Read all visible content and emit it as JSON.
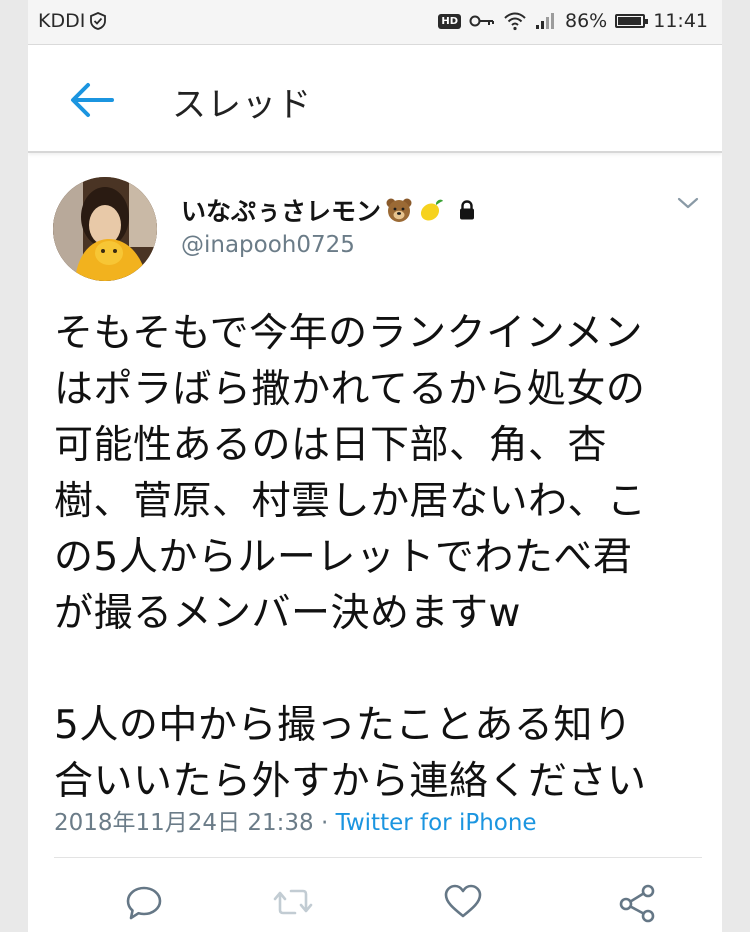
{
  "status_bar": {
    "carrier": "KDDI",
    "hd_badge": "HD",
    "battery_percent": "86%",
    "battery_level": 0.86,
    "time": "11:41"
  },
  "header": {
    "title": "スレッド"
  },
  "tweet": {
    "display_name": "いなぷぅさレモン",
    "name_emojis": [
      "bear-face",
      "lemon"
    ],
    "handle": "@inapooh0725",
    "text": "そもそもで今年のランクインメン\nはポラばら撒かれてるから処女の\n可能性あるのは日下部、角、杏\n樹、菅原、村雲しか居ないわ、こ\nの5人からルーレットでわたべ君\nが撮るメンバー決めますw\n\n5人の中から撮ったことある知り\n合いいたら外すから連絡ください",
    "timestamp": "2018年11月24日 21:38",
    "separator": " · ",
    "source": "Twitter for iPhone"
  },
  "actions": [
    "reply-icon",
    "retweet-icon",
    "like-icon",
    "share-icon"
  ],
  "colors": {
    "accent": "#1b95e0",
    "secondary_text": "#6b7c88",
    "icon_gray": "#657786",
    "retweet_disabled": "#c2ccd3"
  }
}
